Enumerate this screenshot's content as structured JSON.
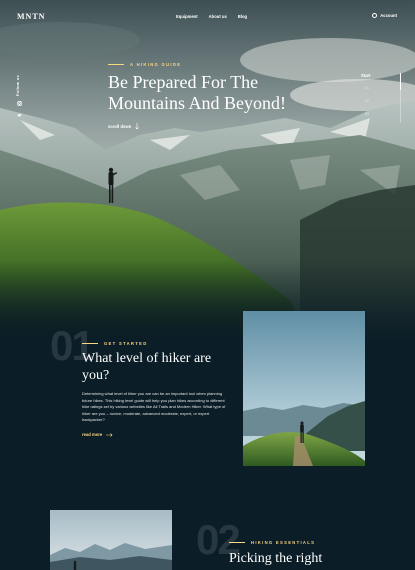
{
  "nav": {
    "logo": "MNTN",
    "links": [
      "Equipment",
      "About us",
      "Blog"
    ],
    "account_label": "Account"
  },
  "hero": {
    "follow_label": "Follow us",
    "social_icons": [
      "instagram-icon",
      "twitter-icon"
    ],
    "eyebrow": "A HIKING GUIDE",
    "title": "Be Prepared For The Mountains And Beyond!",
    "scroll_label": "scroll down",
    "side_nav": {
      "label": "Start",
      "items": [
        "01",
        "02",
        "03"
      ],
      "active_index": 0
    }
  },
  "section1": {
    "number": "01",
    "eyebrow": "GET STARTED",
    "title": "What level of hiker are you?",
    "body": "Determining what level of hiker you are can be an important tool when planning future hikes. This hiking level guide will help you plan hikes according to different hike ratings set by various websites like All Trails and Modern Hiker. What type of hiker are you – novice, moderate, advanced moderate, expert, or expert backpacker?",
    "read_more": "read more"
  },
  "section2": {
    "number": "02",
    "eyebrow": "HIKING ESSENTIALS",
    "title": "Picking the right"
  },
  "colors": {
    "background": "#0b1d26",
    "accent": "#fbd784",
    "text": "#ffffff"
  }
}
